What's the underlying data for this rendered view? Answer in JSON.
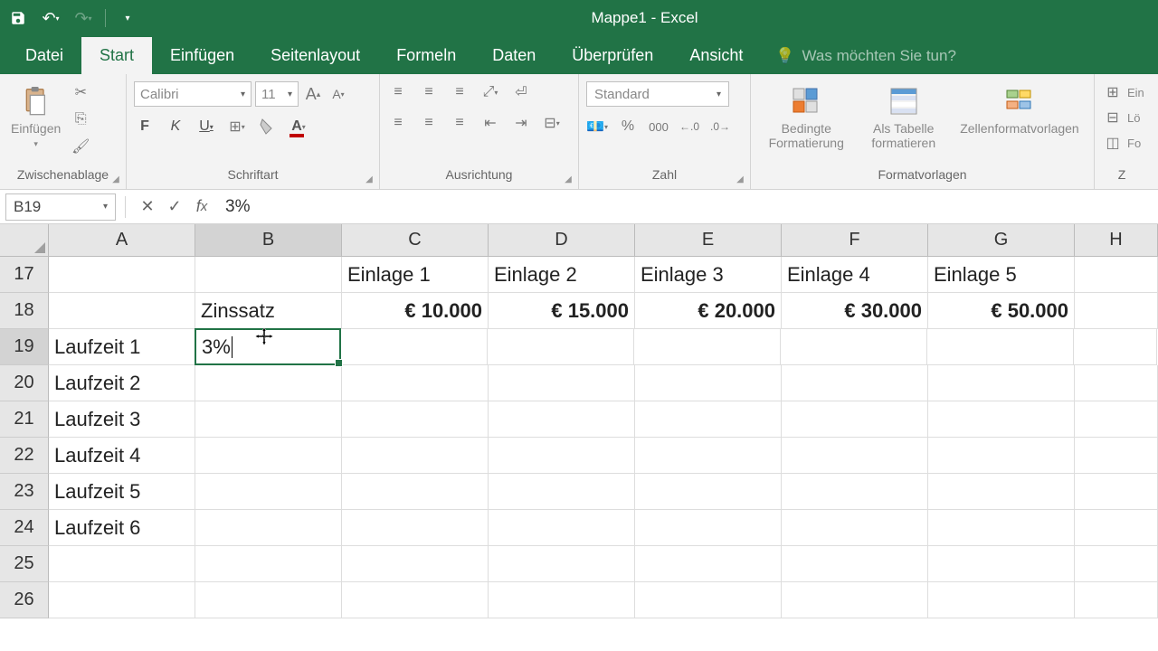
{
  "title": "Mappe1 - Excel",
  "tabs": {
    "file": "Datei",
    "home": "Start",
    "insert": "Einfügen",
    "layout": "Seitenlayout",
    "formulas": "Formeln",
    "data": "Daten",
    "review": "Überprüfen",
    "view": "Ansicht"
  },
  "tell_me": "Was möchten Sie tun?",
  "ribbon": {
    "clipboard": {
      "label": "Zwischenablage",
      "paste": "Einfügen"
    },
    "font": {
      "label": "Schriftart",
      "name": "Calibri",
      "size": "11",
      "bold": "F",
      "italic": "K",
      "underline": "U"
    },
    "alignment": {
      "label": "Ausrichtung"
    },
    "number": {
      "label": "Zahl",
      "format": "Standard"
    },
    "styles": {
      "label": "Formatvorlagen",
      "conditional": "Bedingte Formatierung",
      "table": "Als Tabelle formatieren",
      "cell": "Zellenformatvorlagen"
    },
    "cells": {
      "insert": "Ein",
      "delete": "Lö",
      "format": "Fo"
    }
  },
  "namebox": "B19",
  "formula": "3%",
  "columns": [
    "A",
    "B",
    "C",
    "D",
    "E",
    "F",
    "G",
    "H"
  ],
  "rows": [
    "17",
    "18",
    "19",
    "20",
    "21",
    "22",
    "23",
    "24",
    "25",
    "26"
  ],
  "sheet": {
    "r17": {
      "C": "Einlage 1",
      "D": "Einlage 2",
      "E": "Einlage 3",
      "F": "Einlage 4",
      "G": "Einlage 5"
    },
    "r18": {
      "B": "Zinssatz",
      "C": "€ 10.000",
      "D": "€ 15.000",
      "E": "€ 20.000",
      "F": "€ 30.000",
      "G": "€ 50.000"
    },
    "r19": {
      "A": "Laufzeit 1",
      "B": "3%"
    },
    "r20": {
      "A": "Laufzeit 2"
    },
    "r21": {
      "A": "Laufzeit 3"
    },
    "r22": {
      "A": "Laufzeit 4"
    },
    "r23": {
      "A": "Laufzeit 5"
    },
    "r24": {
      "A": "Laufzeit 6"
    }
  }
}
